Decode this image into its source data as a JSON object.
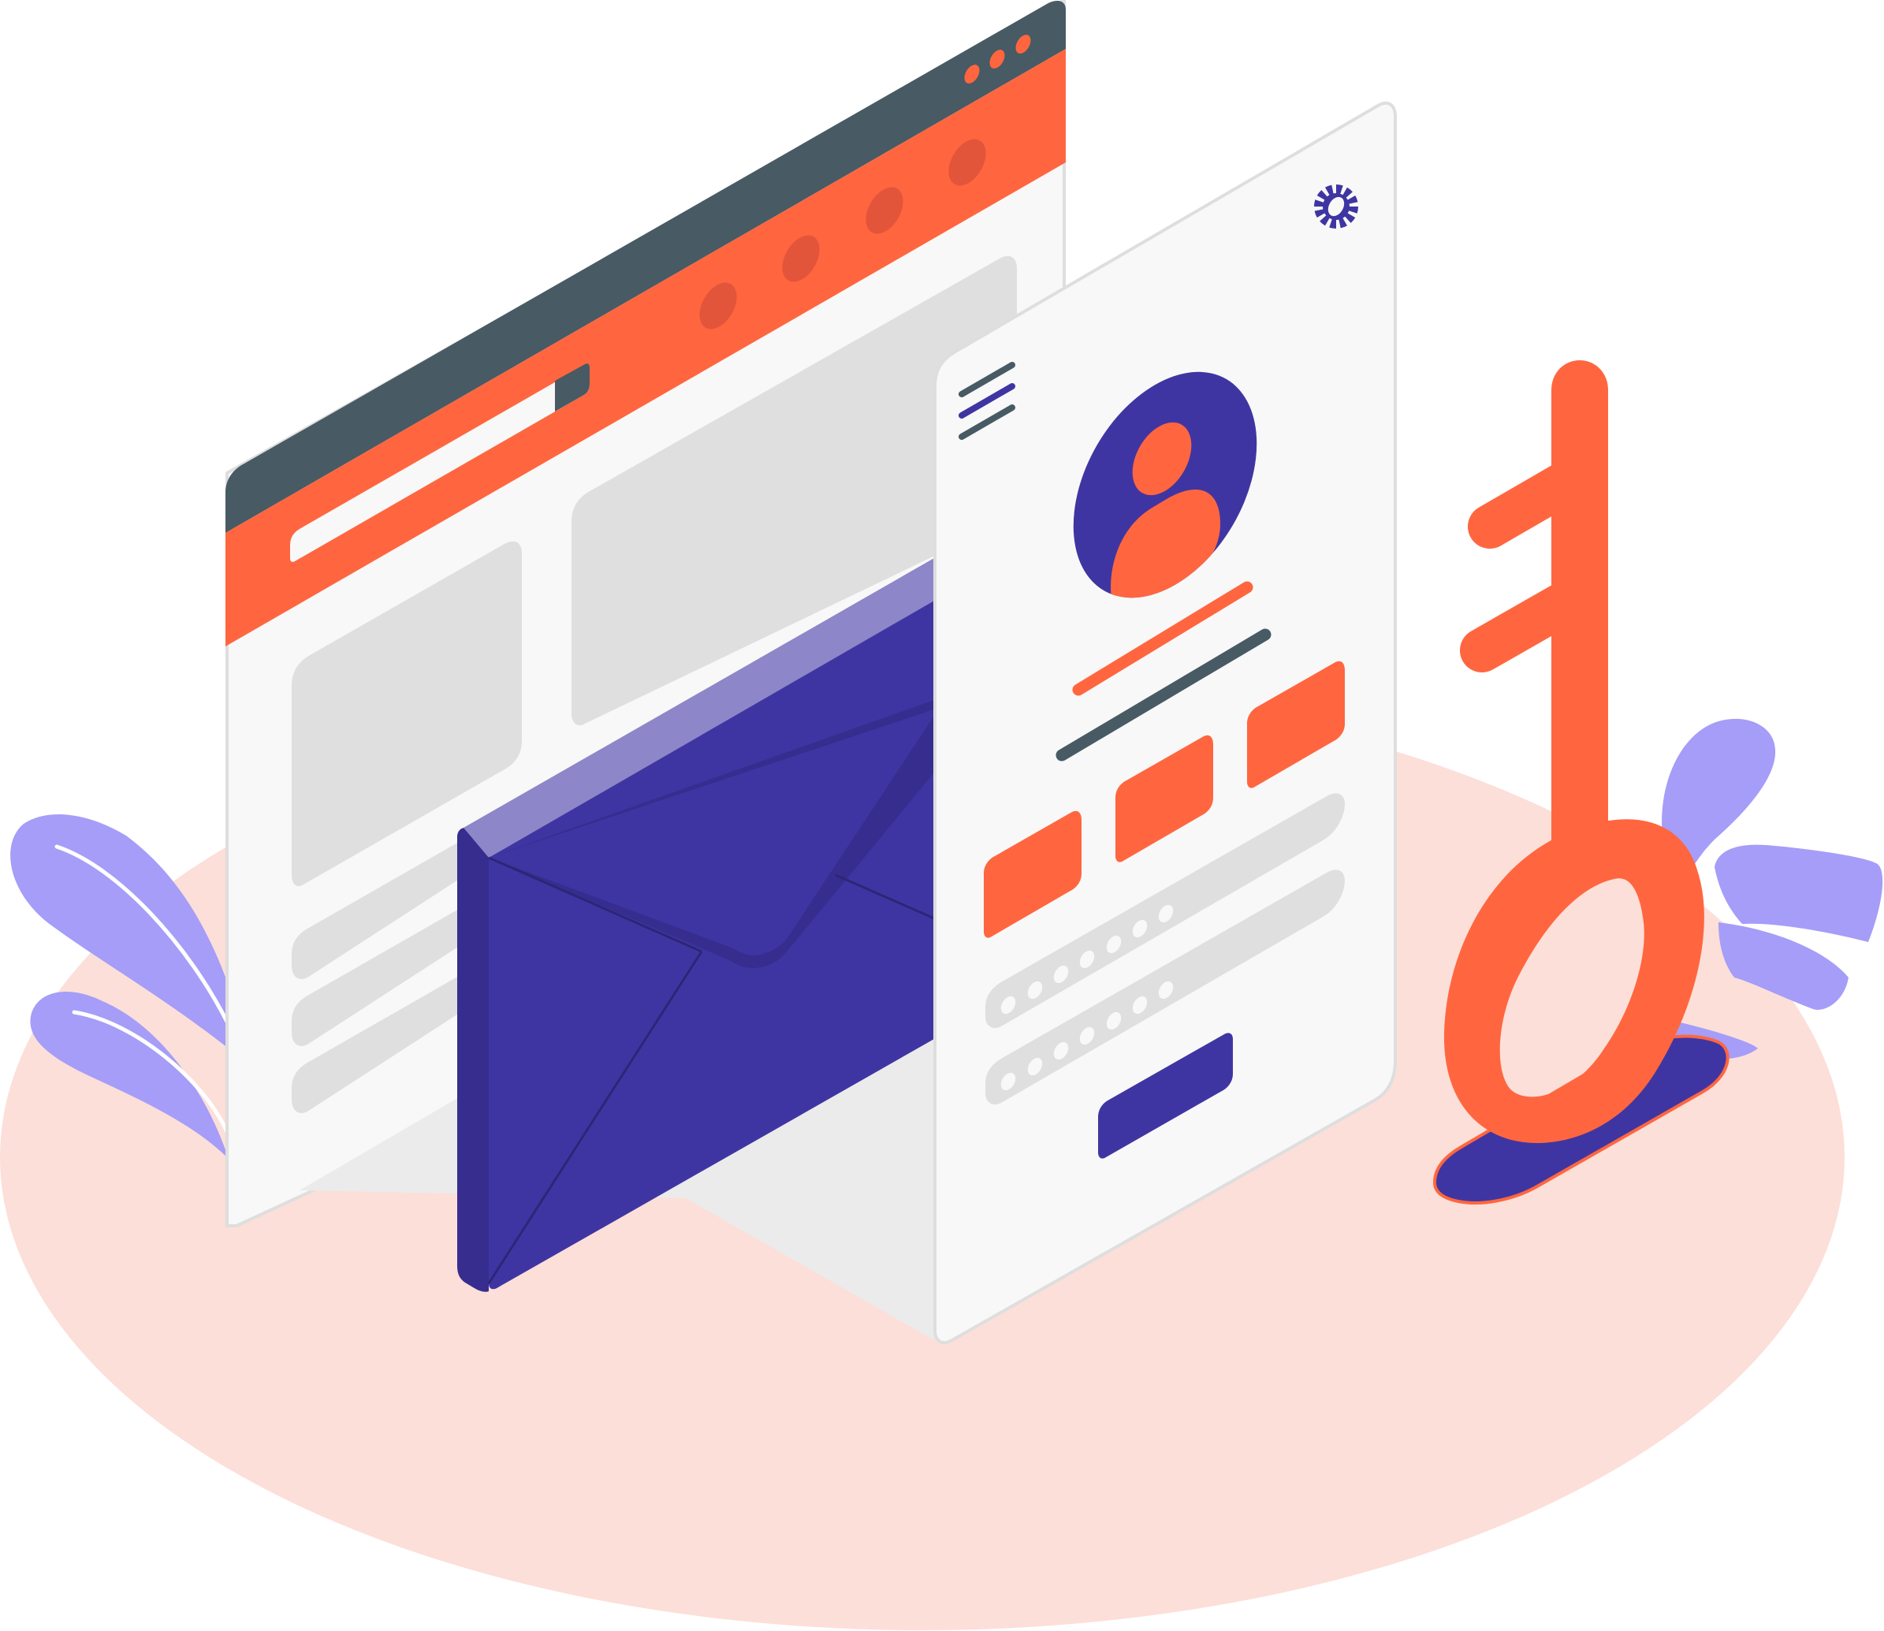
{
  "illustration": {
    "subject": "login-security",
    "icons": [
      "browser-window-icon",
      "email-envelope-icon",
      "login-form-icon",
      "user-avatar-icon",
      "settings-gear-icon",
      "hamburger-menu-icon",
      "key-icon",
      "leaf-plant-icon"
    ]
  },
  "colors": {
    "background": "#ffffff",
    "floor": "#fcdfd8",
    "accent_orange": "#ff663f",
    "accent_orange_dark": "#e2553a",
    "dark_slate": "#485a64",
    "indigo": "#3f35a2",
    "indigo_dark": "#362d8f",
    "indigo_light": "#8d86c8",
    "lavender": "#a59df8",
    "panel": "#f8f8f8",
    "panel_border": "#dedede",
    "placeholder": "#dfdfdf"
  },
  "login_form": {
    "password_dots": 6
  }
}
